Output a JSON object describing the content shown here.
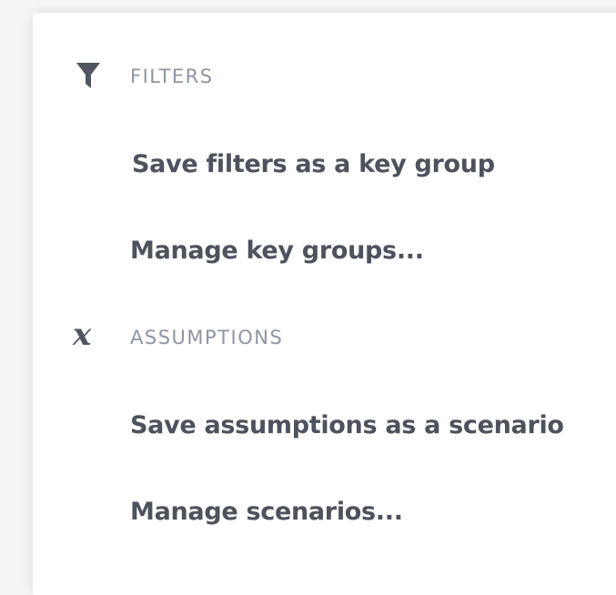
{
  "menu": {
    "filters_section": {
      "icon": "filter-icon",
      "title": "FILTERS",
      "items": [
        {
          "label": "Save filters as a key group"
        },
        {
          "label": "Manage key groups..."
        }
      ]
    },
    "assumptions_section": {
      "icon": "variable-x-icon",
      "title": "ASSUMPTIONS",
      "items": [
        {
          "label": "Save assumptions as a scenario"
        },
        {
          "label": "Manage scenarios..."
        }
      ]
    }
  },
  "colors": {
    "section_title": "#8e95a3",
    "item_text": "#4d525d",
    "icon": "#505660",
    "background": "#ffffff"
  }
}
